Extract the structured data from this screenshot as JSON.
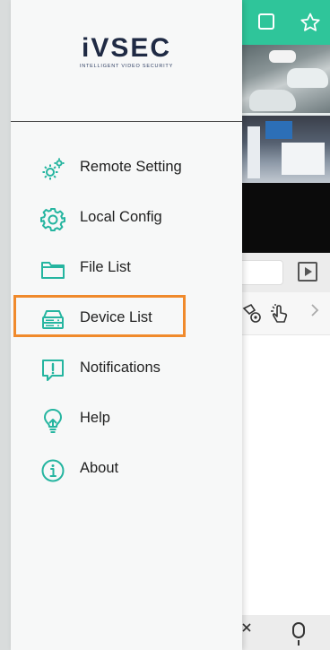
{
  "drawer": {
    "logo_main": "iVSEC",
    "logo_sub": "INTELLIGENT VIDEO SECURITY",
    "items": [
      {
        "label": "Remote Setting",
        "icon": "gears-icon"
      },
      {
        "label": "Local Config",
        "icon": "gear-icon"
      },
      {
        "label": "File List",
        "icon": "folder-icon"
      },
      {
        "label": "Device List",
        "icon": "server-icon"
      },
      {
        "label": "Notifications",
        "icon": "alert-message-icon"
      },
      {
        "label": "Help",
        "icon": "lightbulb-icon"
      },
      {
        "label": "About",
        "icon": "info-icon"
      }
    ],
    "highlighted_item": "Device List"
  },
  "colors": {
    "accent_teal": "#2fc59a",
    "icon_teal": "#25b5a0",
    "highlight_orange": "#f08a2c",
    "logo_navy": "#1f2a44"
  }
}
